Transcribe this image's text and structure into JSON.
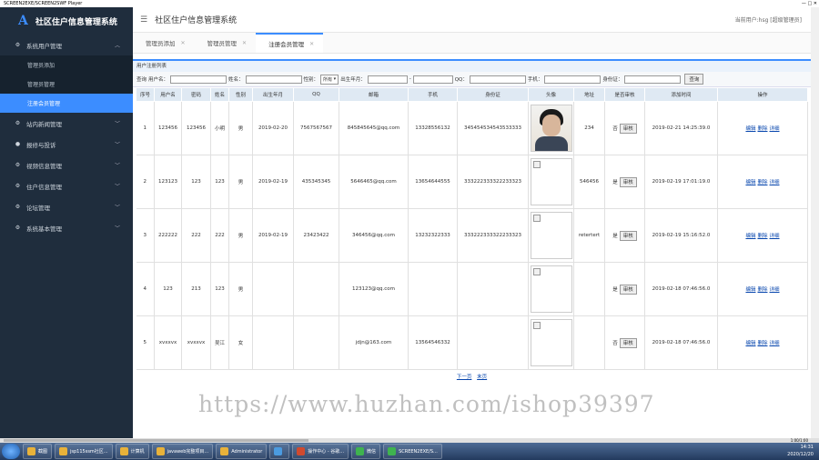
{
  "player": {
    "title": "SCREEN2EXE/SCREEN2SWF Player",
    "window_buttons": "— □ ✕"
  },
  "sidebar": {
    "logo_letter": "A",
    "app_name": "社区住户信息管理系统",
    "groups": [
      {
        "label": "系统用户管理",
        "open": true,
        "items": [
          {
            "label": "管理员添加",
            "active": false
          },
          {
            "label": "管理员管理",
            "active": false
          },
          {
            "label": "注册会员管理",
            "active": true
          }
        ]
      },
      {
        "label": "站内新闻管理",
        "open": false
      },
      {
        "label": "报修与投诉",
        "open": false
      },
      {
        "label": "视频信息管理",
        "open": false
      },
      {
        "label": "住户信息管理",
        "open": false
      },
      {
        "label": "论坛管理",
        "open": false
      },
      {
        "label": "系统基本管理",
        "open": false
      }
    ]
  },
  "header": {
    "title": "社区住户信息管理系统",
    "user": "当前用户:hsg [超级管理员]"
  },
  "tabs": [
    {
      "label": "管理员添加",
      "active": false
    },
    {
      "label": "管理员管理",
      "active": false
    },
    {
      "label": "注册会员管理",
      "active": true
    }
  ],
  "panel": {
    "title": "用户注册列表"
  },
  "search": {
    "query_label": "查询",
    "username_label": "用户名：",
    "name_label": "姓名：",
    "gender_label": "性别：",
    "gender_value": "所有",
    "birth_label": "出生年月：",
    "birth_sep": "-",
    "qq_label": "QQ：",
    "phone_label": "手机：",
    "idcard_label": "身份证：",
    "button": "查询"
  },
  "table": {
    "headers": [
      "序号",
      "用户名",
      "密码",
      "姓名",
      "性别",
      "出生年月",
      "QQ",
      "邮箱",
      "手机",
      "身份证",
      "头像",
      "地址",
      "是否审核",
      "添加时间",
      "操作"
    ],
    "audit_button": "审核",
    "ops": [
      "编辑",
      "删除",
      "详细"
    ],
    "rows": [
      {
        "no": "1",
        "username": "123456",
        "password": "123456",
        "name": "小明",
        "gender": "男",
        "birth": "2019-02-20",
        "qq": "7567567567",
        "email": "845845645@qq.com",
        "phone": "13328556132",
        "idcard": "345454534543533333",
        "avatar": "photo",
        "address": "234",
        "audited": "否",
        "added": "2019-02-21 14:25:39.0"
      },
      {
        "no": "2",
        "username": "123123",
        "password": "123",
        "name": "123",
        "gender": "男",
        "birth": "2019-02-19",
        "qq": "435345345",
        "email": "5646465@qq.com",
        "phone": "13654644555",
        "idcard": "333222333322233323",
        "avatar": "broken",
        "address": "546456",
        "audited": "是",
        "added": "2019-02-19 17:01:19.0"
      },
      {
        "no": "3",
        "username": "222222",
        "password": "222",
        "name": "222",
        "gender": "男",
        "birth": "2019-02-19",
        "qq": "23423422",
        "email": "346456@qq.com",
        "phone": "13232322333",
        "idcard": "333222333322233323",
        "avatar": "broken",
        "address": "retertert",
        "audited": "是",
        "added": "2019-02-19 15:16:52.0"
      },
      {
        "no": "4",
        "username": "123",
        "password": "213",
        "name": "123",
        "gender": "男",
        "birth": "",
        "qq": "",
        "email": "123123@qq.com",
        "phone": "",
        "idcard": "",
        "avatar": "broken",
        "address": "",
        "audited": "是",
        "added": "2019-02-18 07:46:56.0"
      },
      {
        "no": "5",
        "username": "xvxxvx",
        "password": "xvxxvx",
        "name": "吴江",
        "gender": "女",
        "birth": "",
        "qq": "",
        "email": "jdjn@163.com",
        "phone": "13564546332",
        "idcard": "",
        "avatar": "broken",
        "address": "",
        "audited": "否",
        "added": "2019-02-18 07:46:56.0"
      }
    ]
  },
  "pager": {
    "next": "下一页",
    "last": "末页"
  },
  "watermark": "https://www.huzhan.com/ishop39397",
  "player_status": "1:00/1:00",
  "taskbar": {
    "items": [
      {
        "label": "截图",
        "color": "#e8b23a"
      },
      {
        "label": "jsp115ssm社区...",
        "color": "#e8b23a"
      },
      {
        "label": "计算机",
        "color": "#e8b23a"
      },
      {
        "label": "javaweb完整项目...",
        "color": "#e8b23a"
      },
      {
        "label": "Administrator",
        "color": "#e8b23a"
      },
      {
        "label": "",
        "color": "#4b9be0"
      },
      {
        "label": "操作中心 - 谷歌...",
        "color": "#d04a2f"
      },
      {
        "label": "微信",
        "color": "#3fb34f"
      },
      {
        "label": "SCREEN2EXE/S...",
        "color": "#3fb34f"
      }
    ],
    "time": "14:31",
    "date": "2020/12/20"
  }
}
